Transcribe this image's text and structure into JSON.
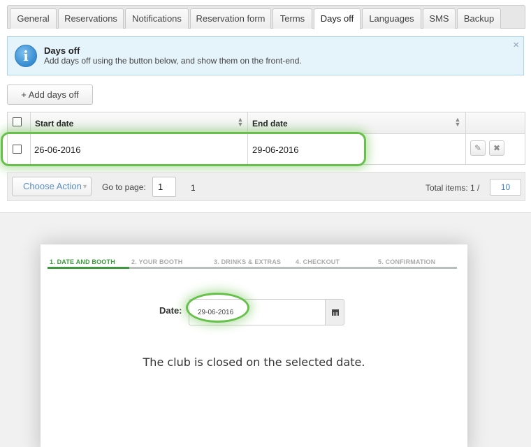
{
  "tabs": [
    {
      "label": "General"
    },
    {
      "label": "Reservations"
    },
    {
      "label": "Notifications"
    },
    {
      "label": "Reservation form"
    },
    {
      "label": "Terms"
    },
    {
      "label": "Days off",
      "active": true
    },
    {
      "label": "Languages"
    },
    {
      "label": "SMS"
    },
    {
      "label": "Backup"
    }
  ],
  "info": {
    "icon": "info-icon",
    "title": "Days off",
    "description": "Add days off using the button below, and show them on the front-end.",
    "close": "×"
  },
  "add_button": "+ Add days off",
  "grid": {
    "columns": [
      "Start date",
      "End date"
    ],
    "rows": [
      {
        "start": "26-06-2016",
        "end": "29-06-2016"
      }
    ],
    "row_actions": {
      "edit": "✎",
      "delete": "✖"
    }
  },
  "footer": {
    "choose_action": "Choose Action",
    "goto_label": "Go to page:",
    "goto_value": "1",
    "page": "1",
    "total_label": "Total items: 1 /",
    "per_page": "10"
  },
  "frontend": {
    "steps": [
      {
        "label": "1. DATE AND BOOTH",
        "active": true
      },
      {
        "label": "2. YOUR BOOTH"
      },
      {
        "label": "3. DRINKS & EXTRAS"
      },
      {
        "label": "4. CHECKOUT"
      },
      {
        "label": "5. CONFIRMATION"
      }
    ],
    "date_label": "Date:",
    "date_value": "29-06-2016",
    "closed_message": "The club is closed on the selected date."
  },
  "colors": {
    "accent_green": "#3b9a3b",
    "highlight_green": "#66c04a",
    "info_bg": "#e5f3fb",
    "link_blue": "#3e7fb4"
  }
}
